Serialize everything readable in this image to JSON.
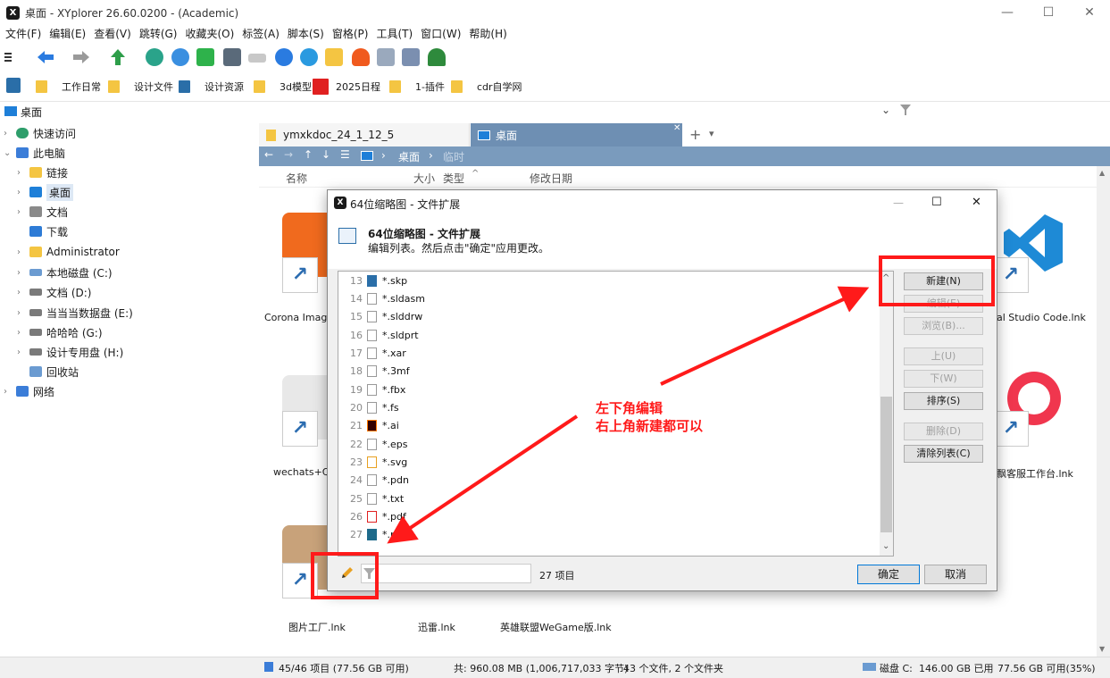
{
  "window": {
    "title": "桌面 - XYplorer 26.60.0200 - (Academic)",
    "min": "—",
    "max": "☐",
    "close": "✕"
  },
  "menu": [
    "文件(F)",
    "编辑(E)",
    "查看(V)",
    "跳转(G)",
    "收藏夹(O)",
    "标签(A)",
    "脚本(S)",
    "窗格(P)",
    "工具(T)",
    "窗口(W)",
    "帮助(H)"
  ],
  "favorites": [
    "工作日常",
    "设计文件",
    "设计资源",
    "3d模型",
    "2025日程",
    "1-插件",
    "cdr自学网"
  ],
  "address": {
    "value": "桌面"
  },
  "tree": [
    {
      "label": "快速访问",
      "expander": "›",
      "color": "#2e9e6b"
    },
    {
      "label": "此电脑",
      "expander": "⌄",
      "color": "#3b7dd8"
    },
    {
      "label": "链接",
      "expander": "›",
      "color": "#f4c542"
    },
    {
      "label": "桌面",
      "expander": "›",
      "color": "#1e7fd8"
    },
    {
      "label": "文档",
      "expander": "›",
      "color": "#8a8a8a"
    },
    {
      "label": "下载",
      "expander": "",
      "color": "#2e7bd6"
    },
    {
      "label": "Administrator",
      "expander": "›",
      "color": "#f4c542"
    },
    {
      "label": "本地磁盘 (C:)",
      "expander": "›",
      "color": "#6b9bd1"
    },
    {
      "label": "文档 (D:)",
      "expander": "›",
      "color": "#7a7a7a"
    },
    {
      "label": "当当当数据盘 (E:)",
      "expander": "›",
      "color": "#7a7a7a"
    },
    {
      "label": "哈哈哈 (G:)",
      "expander": "›",
      "color": "#7a7a7a"
    },
    {
      "label": "设计专用盘 (H:)",
      "expander": "›",
      "color": "#7a7a7a"
    },
    {
      "label": "回收站",
      "expander": "",
      "color": "#6b9bd1"
    },
    {
      "label": "网络",
      "expander": "›",
      "color": "#3b7dd8"
    }
  ],
  "tabs": [
    {
      "label": "ymxkdoc_24_1_12_5"
    },
    {
      "label": "桌面"
    }
  ],
  "tab_add": "+",
  "tab_menu": "▾",
  "breadcrumb": {
    "path": [
      "桌面",
      "临时"
    ],
    "sep": "›"
  },
  "columns": {
    "name": "名称",
    "size": "大小",
    "type": "类型",
    "modified": "修改日期"
  },
  "files": {
    "left": [
      "Corona Image",
      "wechats+QC",
      "图片工厂.lnk"
    ],
    "middle": [
      "迅雷.lnk",
      "英雄联盟WeGame版.lnk"
    ],
    "right": [
      "al Studio Code.lnk",
      "飘客服工作台.lnk"
    ]
  },
  "status": {
    "items": "45/46 项目 (77.56 GB 可用)",
    "total": "共: 960.08 MB (1,006,717,033 字节)",
    "counts": "43 个文件, 2 个文件夹",
    "disk": "磁盘 C:",
    "used": "146.00 GB 已用",
    "free": "77.56 GB 可用(35%)"
  },
  "dialog": {
    "title": "64位缩略图 - 文件扩展",
    "heading": "64位缩略图 - 文件扩展",
    "subheading": "编辑列表。然后点击\"确定\"应用更改。",
    "rows": [
      {
        "num": "13",
        "ext": "*.skp"
      },
      {
        "num": "14",
        "ext": "*.sldasm"
      },
      {
        "num": "15",
        "ext": "*.slddrw"
      },
      {
        "num": "16",
        "ext": "*.sldprt"
      },
      {
        "num": "17",
        "ext": "*.xar"
      },
      {
        "num": "18",
        "ext": "*.3mf"
      },
      {
        "num": "19",
        "ext": "*.fbx"
      },
      {
        "num": "20",
        "ext": "*.fs"
      },
      {
        "num": "21",
        "ext": "*.ai"
      },
      {
        "num": "22",
        "ext": "*.eps"
      },
      {
        "num": "23",
        "ext": "*.svg"
      },
      {
        "num": "24",
        "ext": "*.pdn"
      },
      {
        "num": "25",
        "ext": "*.txt"
      },
      {
        "num": "26",
        "ext": "*.pdf"
      },
      {
        "num": "27",
        "ext": "*.m"
      }
    ],
    "buttons": {
      "new": "新建(N)",
      "edit": "编辑(E)",
      "browse": "浏览(B)...",
      "up": "上(U)",
      "down": "下(W)",
      "sort": "排序(S)",
      "delete": "删除(D)",
      "clear": "清除列表(C)"
    },
    "count_label": "27 项目",
    "ok": "确定",
    "cancel": "取消",
    "filter_value": ""
  },
  "annotation": {
    "line1": "左下角编辑",
    "line2": "右上角新建都可以"
  },
  "colors": {
    "accent": "#ff1a1a",
    "breadcrumb_bg": "#7a9bbd",
    "tab_active": "#6e8fb3"
  }
}
